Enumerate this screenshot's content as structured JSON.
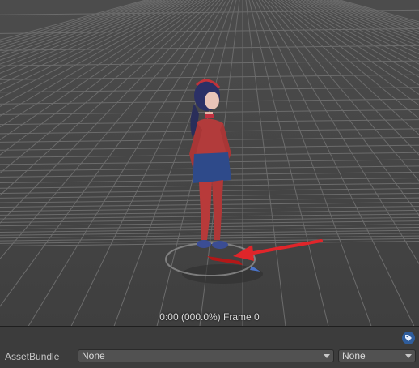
{
  "preview": {
    "time_readout": "0:00 (000.0%) Frame 0"
  },
  "asset_bundle": {
    "label": "AssetBundle",
    "name_dropdown_value": "None",
    "variant_dropdown_value": "None"
  },
  "icons": {
    "tag": "tag-icon",
    "expand_arrow": "chevron-down-icon"
  },
  "colors": {
    "viewport_background": "#4a4a4a",
    "grid_line": "#6e6e6e",
    "annotation_arrow": "#e0252a",
    "panel_background": "#3c3c3c"
  }
}
